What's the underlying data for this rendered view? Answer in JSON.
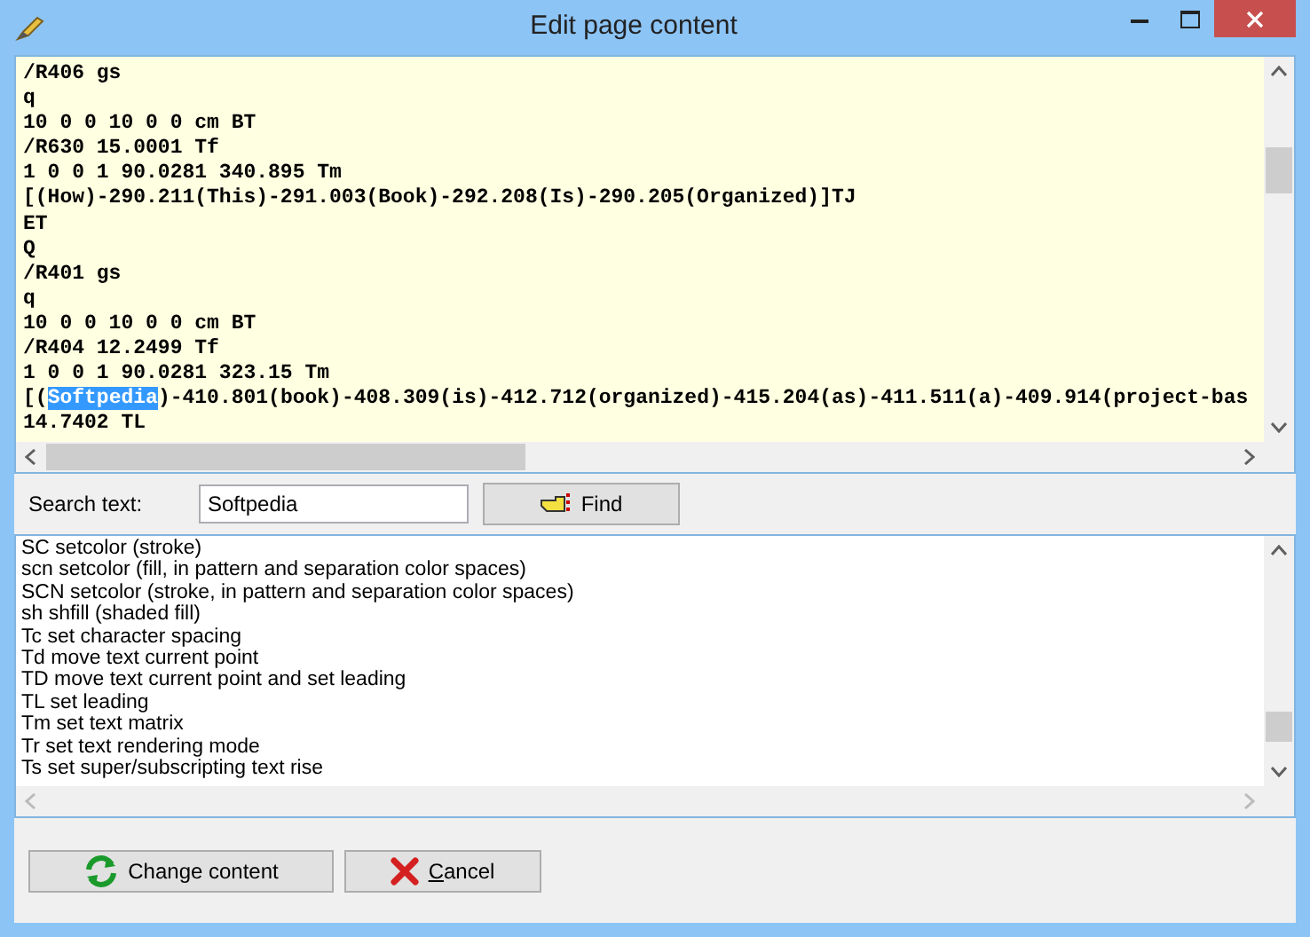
{
  "window": {
    "title": "Edit page content"
  },
  "editor": {
    "lines": [
      {
        "parts": [
          {
            "text": "/R406 gs",
            "selected": false
          }
        ]
      },
      {
        "parts": [
          {
            "text": "q",
            "selected": false
          }
        ]
      },
      {
        "parts": [
          {
            "text": "10 0 0 10 0 0 cm BT",
            "selected": false
          }
        ]
      },
      {
        "parts": [
          {
            "text": "/R630 15.0001 Tf",
            "selected": false
          }
        ]
      },
      {
        "parts": [
          {
            "text": "1 0 0 1 90.0281 340.895 Tm",
            "selected": false
          }
        ]
      },
      {
        "parts": [
          {
            "text": "[(How)-290.211(This)-291.003(Book)-292.208(Is)-290.205(Organized)]TJ",
            "selected": false
          }
        ]
      },
      {
        "parts": [
          {
            "text": "ET",
            "selected": false
          }
        ]
      },
      {
        "parts": [
          {
            "text": "Q",
            "selected": false
          }
        ]
      },
      {
        "parts": [
          {
            "text": "/R401 gs",
            "selected": false
          }
        ]
      },
      {
        "parts": [
          {
            "text": "q",
            "selected": false
          }
        ]
      },
      {
        "parts": [
          {
            "text": "10 0 0 10 0 0 cm BT",
            "selected": false
          }
        ]
      },
      {
        "parts": [
          {
            "text": "/R404 12.2499 Tf",
            "selected": false
          }
        ]
      },
      {
        "parts": [
          {
            "text": "1 0 0 1 90.0281 323.15 Tm",
            "selected": false
          }
        ]
      },
      {
        "parts": [
          {
            "text": "[(",
            "selected": false
          },
          {
            "text": "Softpedia",
            "selected": true
          },
          {
            "text": ")-410.801(book)-408.309(is)-412.712(organized)-415.204(as)-411.511(a)-409.914(project-bas",
            "selected": false
          }
        ]
      },
      {
        "parts": [
          {
            "text": "14.7402 TL",
            "selected": false
          }
        ]
      }
    ]
  },
  "search": {
    "label": "Search text:",
    "value": "Softpedia",
    "button": "Find"
  },
  "operators": [
    "SC setcolor (stroke)",
    "scn setcolor (fill, in pattern and separation color spaces)",
    "SCN setcolor (stroke, in pattern and separation color spaces)",
    "sh shfill (shaded fill)",
    "Tc set character spacing",
    "Td move text current point",
    "TD move text current point and set leading",
    "TL set leading",
    "Tm set text matrix",
    "Tr set text rendering mode",
    "Ts set super/subscripting text rise"
  ],
  "buttons": [
    {
      "label_parts": [
        {
          "text": "Change content",
          "underlined": false
        }
      ],
      "kind": "apply"
    },
    {
      "label_parts": [
        {
          "text": "C",
          "underlined": true
        },
        {
          "text": "ancel",
          "underlined": false
        }
      ],
      "kind": "cancel"
    }
  ]
}
